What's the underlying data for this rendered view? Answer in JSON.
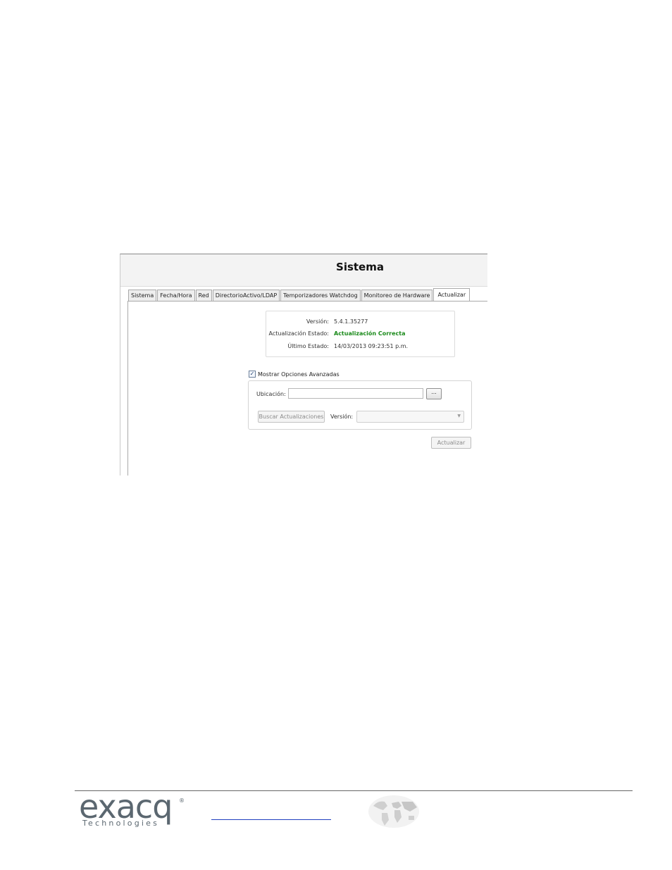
{
  "window": {
    "title": "Sistema"
  },
  "tabs": [
    {
      "label": "Sistema"
    },
    {
      "label": "Fecha/Hora"
    },
    {
      "label": "Red"
    },
    {
      "label": "DirectorioActivo/LDAP"
    },
    {
      "label": "Temporizadores Watchdog"
    },
    {
      "label": "Monitoreo de Hardware"
    },
    {
      "label": "Actualizar",
      "active": true
    }
  ],
  "status": {
    "version_label": "Versión:",
    "version_value": "5.4.1.35277",
    "update_state_label": "Actualización Estado:",
    "update_state_value": "Actualización Correcta",
    "last_state_label": "Último Estado:",
    "last_state_value": "14/03/2013 09:23:51 p.m.",
    "success_color": "#1a8a1a"
  },
  "advanced": {
    "checkbox_label": "Mostrar Opciones Avanzadas",
    "checked": true,
    "location_label": "Ubicación:",
    "location_value": "",
    "browse_label": "...",
    "search_button_label": "Buscar Actualizaciones",
    "version_label": "Versión:",
    "version_selected": ""
  },
  "actions": {
    "update_button_label": "Actualizar"
  },
  "footer": {
    "logo_word": "exacq",
    "logo_sub": "Technologies",
    "logo_reg": "®",
    "logo_color": "#5b6770",
    "link_color": "#1f3fbf"
  }
}
